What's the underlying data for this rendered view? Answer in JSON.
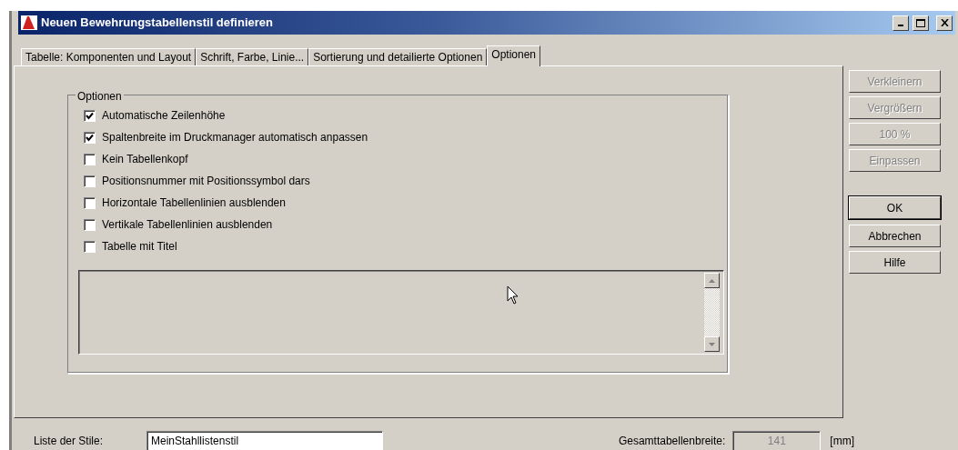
{
  "window": {
    "title": "Neuen Bewehrungstabellenstil definieren"
  },
  "tabs": [
    {
      "label": "Tabelle: Komponenten und Layout",
      "selected": false
    },
    {
      "label": "Schrift, Farbe, Linie...",
      "selected": false
    },
    {
      "label": "Sortierung und detailierte Optionen",
      "selected": false
    },
    {
      "label": "Optionen",
      "selected": true
    }
  ],
  "options_group": {
    "title": "Optionen",
    "options": [
      {
        "label": "Automatische Zeilenhöhe",
        "checked": true
      },
      {
        "label": "Spaltenbreite im Druckmanager automatisch anpassen",
        "checked": true
      },
      {
        "label": "Kein Tabellenkopf",
        "checked": false
      },
      {
        "label": "Positionsnummer mit Positionssymbol dars",
        "checked": false
      },
      {
        "label": "Horizontale Tabellenlinien ausblenden",
        "checked": false
      },
      {
        "label": "Vertikale Tabellenlinien ausblenden",
        "checked": false
      },
      {
        "label": "Tabelle mit Titel",
        "checked": false
      }
    ]
  },
  "side_buttons": [
    {
      "label": "Verkleinern",
      "disabled": true,
      "default": false
    },
    {
      "label": "Vergrößern",
      "disabled": true,
      "default": false
    },
    {
      "label": "100 %",
      "disabled": true,
      "default": false
    },
    {
      "label": "Einpassen",
      "disabled": true,
      "default": false
    },
    {
      "label": "OK",
      "disabled": false,
      "default": true
    },
    {
      "label": "Abbrechen",
      "disabled": false,
      "default": false
    },
    {
      "label": "Hilfe",
      "disabled": false,
      "default": false
    }
  ],
  "bottom": {
    "style_label": "Liste der Stile:",
    "style_value": "MeinStahllistenstil",
    "width_label": "Gesamttabellenbreite:",
    "width_value": "141",
    "width_unit": "[mm]"
  }
}
